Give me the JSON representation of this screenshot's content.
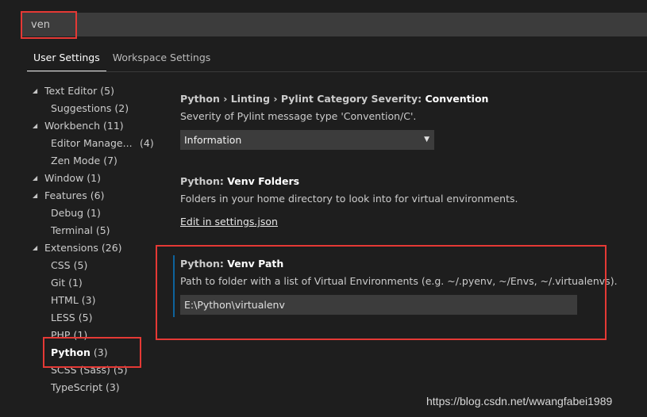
{
  "search": {
    "value": "ven"
  },
  "tabs": [
    {
      "label": "User Settings",
      "active": true
    },
    {
      "label": "Workspace Settings",
      "active": false
    }
  ],
  "tree": [
    {
      "label": "Text Editor",
      "count": "(5)",
      "level": 0,
      "expanded": true
    },
    {
      "label": "Suggestions",
      "count": "(2)",
      "level": 1
    },
    {
      "label": "Workbench",
      "count": "(11)",
      "level": 0,
      "expanded": true
    },
    {
      "label": "Editor Manage...",
      "count": "(4)",
      "level": 1
    },
    {
      "label": "Zen Mode",
      "count": "(7)",
      "level": 1
    },
    {
      "label": "Window",
      "count": "(1)",
      "level": 0,
      "expanded": true
    },
    {
      "label": "Features",
      "count": "(6)",
      "level": 0,
      "expanded": true
    },
    {
      "label": "Debug",
      "count": "(1)",
      "level": 1
    },
    {
      "label": "Terminal",
      "count": "(5)",
      "level": 1
    },
    {
      "label": "Extensions",
      "count": "(26)",
      "level": 0,
      "expanded": true
    },
    {
      "label": "CSS",
      "count": "(5)",
      "level": 1
    },
    {
      "label": "Git",
      "count": "(1)",
      "level": 1
    },
    {
      "label": "HTML",
      "count": "(3)",
      "level": 1
    },
    {
      "label": "LESS",
      "count": "(5)",
      "level": 1
    },
    {
      "label": "PHP",
      "count": "(1)",
      "level": 1
    },
    {
      "label": "Python",
      "count": "(3)",
      "level": 1,
      "selected": true
    },
    {
      "label": "SCSS (Sass)",
      "count": "(5)",
      "level": 1
    },
    {
      "label": "TypeScript",
      "count": "(3)",
      "level": 1
    }
  ],
  "settings": {
    "linting": {
      "category": "Python › Linting › Pylint Category Severity: ",
      "key": "Convention",
      "description": "Severity of Pylint message type 'Convention/C'.",
      "selected_value": "Information"
    },
    "venv_folders": {
      "category": "Python: ",
      "key": "Venv Folders",
      "description": "Folders in your home directory to look into for virtual environments.",
      "link": "Edit in settings.json"
    },
    "venv_path": {
      "category": "Python: ",
      "key": "Venv Path",
      "description": "Path to folder with a list of Virtual Environments (e.g. ~/.pyenv, ~/Envs, ~/.virtualenvs).",
      "value": "E:\\Python\\virtualenv"
    }
  },
  "watermark": "https://blog.csdn.net/wwangfabei1989",
  "colors": {
    "highlight": "#e53935",
    "focus": "#0e639c",
    "background": "#1e1e1e"
  }
}
